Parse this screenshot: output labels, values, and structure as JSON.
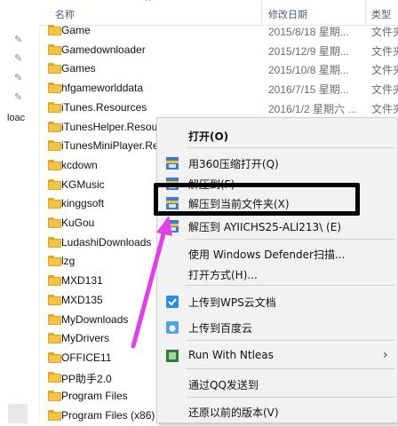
{
  "header": {
    "name_col": "名称",
    "date_col": "修改日期",
    "type_col": "类型"
  },
  "left_pane": {
    "partial_text": "loac"
  },
  "files": [
    {
      "name": "Game",
      "date": "2015/8/18 星期...",
      "type": "文件夹"
    },
    {
      "name": "Gamedownloader",
      "date": "2015/12/9 星期...",
      "type": "文件夹"
    },
    {
      "name": "Games",
      "date": "2015/10/8 星期...",
      "type": "文件夹"
    },
    {
      "name": "hfgameworlddata",
      "date": "2016/7/15 星期...",
      "type": "文件夹"
    },
    {
      "name": "iTunes.Resources",
      "date": "2016/1/2 星期六 ...",
      "type": "文件夹"
    },
    {
      "name": "iTunesHelper.Resour",
      "date": "",
      "type": ""
    },
    {
      "name": "iTunesMiniPlayer.Re",
      "date": "",
      "type": ""
    },
    {
      "name": "kcdown",
      "date": "",
      "type": ""
    },
    {
      "name": "KGMusic",
      "date": "",
      "type": ""
    },
    {
      "name": "kinggsoft",
      "date": "",
      "type": ""
    },
    {
      "name": "KuGou",
      "date": "",
      "type": ""
    },
    {
      "name": "LudashiDownloads",
      "date": "",
      "type": ""
    },
    {
      "name": "lzg",
      "date": "",
      "type": ""
    },
    {
      "name": "MXD131",
      "date": "",
      "type": ""
    },
    {
      "name": "MXD135",
      "date": "",
      "type": ""
    },
    {
      "name": "MyDownloads",
      "date": "",
      "type": ""
    },
    {
      "name": "MyDrivers",
      "date": "",
      "type": ""
    },
    {
      "name": "OFFICE11",
      "date": "",
      "type": ""
    },
    {
      "name": "PP助手2.0",
      "date": "",
      "type": ""
    },
    {
      "name": "Program Files",
      "date": "",
      "type": ""
    },
    {
      "name": "Program Files (x86)",
      "date": "",
      "type": ""
    }
  ],
  "context_menu": {
    "open": "打开(O)",
    "open_360": "用360压缩打开(Q)",
    "extract_to": "解压到(F)",
    "extract_here": "解压到当前文件夹(X)",
    "extract_named": "解压到 AYIICHS25-ALI213\\ (E)",
    "defender": "使用 Windows Defender扫描...",
    "open_with": "打开方式(H)...",
    "upload_wps": "上传到WPS云文档",
    "upload_baidu": "上传到百度云",
    "ntleas": "Run With Ntleas",
    "send_qq": "通过QQ发送到",
    "restore": "还原以前的版本(V)"
  },
  "colors": {
    "annotation_arrow": "#e040e8",
    "highlight_box": "#000000",
    "folder": "#f5c446"
  }
}
